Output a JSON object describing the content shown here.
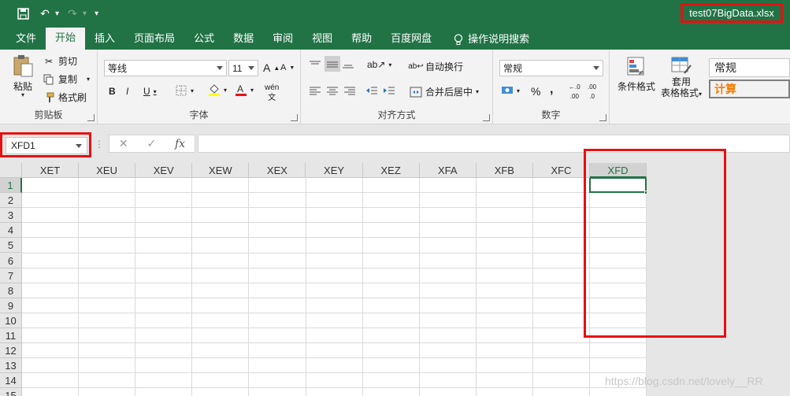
{
  "title_bar": {
    "filename": "test07BigData.xlsx"
  },
  "tabs": [
    "文件",
    "开始",
    "插入",
    "页面布局",
    "公式",
    "数据",
    "审阅",
    "视图",
    "帮助",
    "百度网盘"
  ],
  "tell_me": "操作说明搜索",
  "clipboard": {
    "paste": "粘贴",
    "cut": "剪切",
    "copy": "复制",
    "format_painter": "格式刷",
    "label": "剪贴板"
  },
  "font": {
    "name": "等线",
    "size": "11",
    "label": "字体",
    "bold": "B",
    "italic": "I",
    "underline": "U",
    "grow": "A",
    "shrink": "A",
    "phonetic": "wén"
  },
  "alignment": {
    "wrap": "自动换行",
    "merge": "合并后居中",
    "label": "对齐方式"
  },
  "number": {
    "format": "常规",
    "percent": "%",
    "comma": ",",
    "label": "数字",
    "inc_decimal": ".00",
    "dec_decimal": ".0"
  },
  "styles": {
    "conditional": "条件格式",
    "table_format_1": "套用",
    "table_format_2": "表格格式",
    "normal": "常规",
    "calc": "计算"
  },
  "formula_bar": {
    "name_box": "XFD1",
    "cancel": "✕",
    "enter": "✓",
    "fx": "fx"
  },
  "columns": [
    "XET",
    "XEU",
    "XEV",
    "XEW",
    "XEX",
    "XEY",
    "XEZ",
    "XFA",
    "XFB",
    "XFC",
    "XFD"
  ],
  "rows": [
    "1",
    "2",
    "3",
    "4",
    "5",
    "6",
    "7",
    "8",
    "9",
    "10",
    "11",
    "12",
    "13",
    "14",
    "15"
  ],
  "selected": {
    "column": "XFD",
    "row": "1"
  },
  "watermark": "https://blog.csdn.net/lovely__RR",
  "colors": {
    "brand": "#217346",
    "highlight": "#e81010"
  }
}
